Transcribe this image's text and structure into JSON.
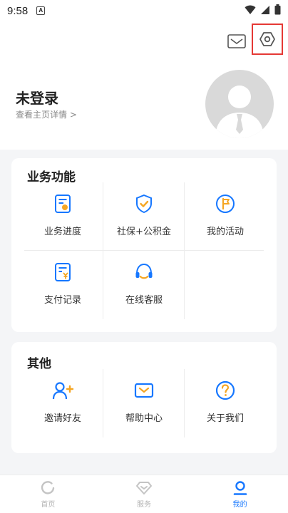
{
  "status": {
    "time": "9:58",
    "notification_glyph": "A"
  },
  "header": {
    "mail_icon": "mail-icon",
    "settings_icon": "settings-hexagon-icon"
  },
  "user": {
    "title": "未登录",
    "subtitle": "查看主页详情 >"
  },
  "business": {
    "title": "业务功能",
    "items": [
      {
        "label": "业务进度",
        "icon": "progress-doc-icon"
      },
      {
        "label": "社保+公积金",
        "icon": "shield-check-icon"
      },
      {
        "label": "我的活动",
        "icon": "flag-icon"
      },
      {
        "label": "支付记录",
        "icon": "payment-record-icon"
      },
      {
        "label": "在线客服",
        "icon": "headset-icon"
      }
    ]
  },
  "other": {
    "title": "其他",
    "items": [
      {
        "label": "邀请好友",
        "icon": "invite-user-icon"
      },
      {
        "label": "帮助中心",
        "icon": "help-mail-icon"
      },
      {
        "label": "关于我们",
        "icon": "question-icon"
      }
    ]
  },
  "tabs": [
    {
      "label": "首页",
      "active": false
    },
    {
      "label": "服务",
      "active": false
    },
    {
      "label": "我的",
      "active": true
    }
  ],
  "colors": {
    "accent": "#1677ff",
    "icon_orange": "#f5a623",
    "highlight_box": "#e53935"
  }
}
